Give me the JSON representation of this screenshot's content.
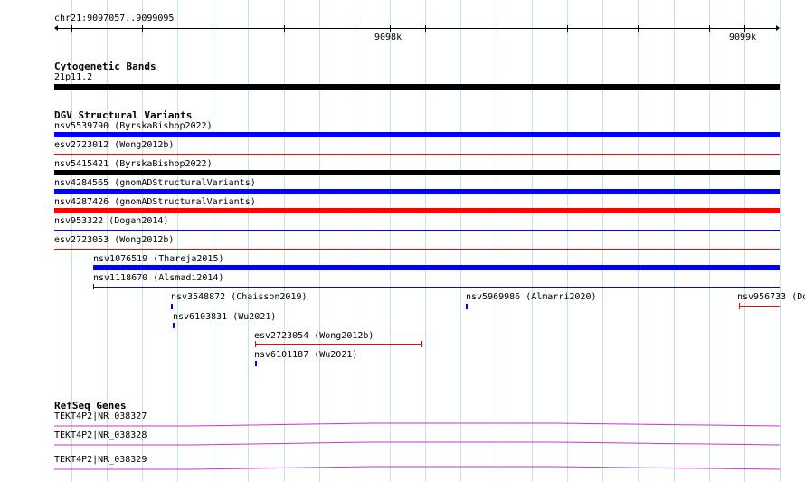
{
  "ruler": {
    "position": "chr21:9097057..9099095",
    "tick_1": "9098k",
    "tick_2": "9099k"
  },
  "tracks": {
    "cytoband": {
      "title": "Cytogenetic Bands",
      "band_label": "21p11.2",
      "band_color": "#000000"
    },
    "dgv": {
      "title": "DGV Structural Variants",
      "items": [
        {
          "label": "nsv5539790 (ByrskaBishop2022)",
          "color": "#0000ff"
        },
        {
          "label": "esv2723012 (Wong2012b)",
          "color": "#ff0000"
        },
        {
          "label": "nsv5415421 (ByrskaBishop2022)",
          "color": "#000000"
        },
        {
          "label": "nsv4284565 (gnomADStructuralVariants)",
          "color": "#0000ff"
        },
        {
          "label": "nsv4287426 (gnomADStructuralVariants)",
          "color": "#ff0000"
        },
        {
          "label": "nsv953322 (Dogan2014)",
          "color": "#0000ff"
        },
        {
          "label": "esv2723053 (Wong2012b)",
          "color": "#ff0000"
        },
        {
          "label": "nsv1076519 (Thareja2015)",
          "color": "#0000ff"
        },
        {
          "label": "nsv1118670 (Alsmadi2014)",
          "color": "#0000ff"
        },
        {
          "label": "nsv3548872 (Chaisson2019)",
          "color": "#0000ff"
        },
        {
          "label": "nsv5969986 (Almarri2020)",
          "color": "#0000ff"
        },
        {
          "label": "nsv956733 (Do",
          "color": "#ff0000"
        },
        {
          "label": "nsv6103831 (Wu2021)",
          "color": "#0000ff"
        },
        {
          "label": "esv2723054 (Wong2012b)",
          "color": "#ff0000"
        },
        {
          "label": "nsv6101187 (Wu2021)",
          "color": "#0000ff"
        }
      ]
    },
    "refseq": {
      "title": "RefSeq Genes",
      "gene_color": "#cc33cc",
      "items": [
        {
          "label": "TEKT4P2|NR_038327"
        },
        {
          "label": "TEKT4P2|NR_038328"
        },
        {
          "label": "TEKT4P2|NR_038329"
        }
      ]
    }
  }
}
